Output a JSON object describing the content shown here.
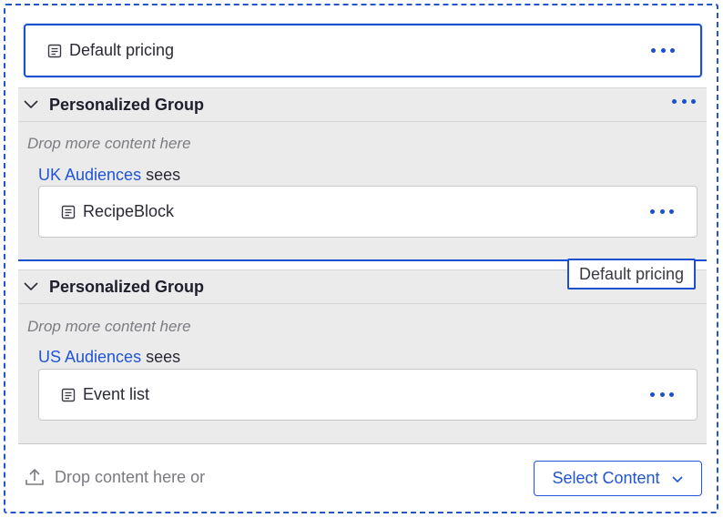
{
  "top_item": {
    "label": "Default pricing",
    "icon": "block-icon"
  },
  "groups": [
    {
      "title": "Personalized Group",
      "drop_hint": "Drop more content here",
      "audience": "UK Audiences",
      "sees": "sees",
      "item": {
        "label": "RecipeBlock",
        "icon": "block-icon"
      }
    },
    {
      "title": "Personalized Group",
      "drop_hint": "Drop more content here",
      "audience": "US Audiences",
      "sees": "sees",
      "item": {
        "label": "Event list",
        "icon": "block-icon"
      }
    }
  ],
  "drag_tooltip": "Default pricing",
  "footer": {
    "drop_text": "Drop content here or",
    "select_button": "Select Content",
    "upload_icon": "upload-icon"
  },
  "colors": {
    "accent": "#1a4fd0",
    "link": "#2154d6",
    "group_bg": "#ebebec",
    "hint": "#7c7c82"
  }
}
